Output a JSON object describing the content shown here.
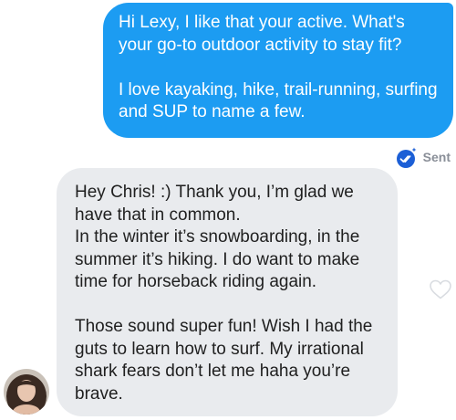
{
  "conversation": {
    "sent_message": {
      "text": "Hi Lexy, I like that your active. What's your go-to outdoor activity to stay fit?\n\nI love kayaking, hike, trail-running, surfing and SUP to name a few.",
      "status_label": "Sent",
      "status_icon": "double-check-icon"
    },
    "received_message": {
      "text": "Hey Chris! :) Thank you, I’m glad we have that in common.\nIn the winter it’s snowboarding, in the summer it’s hiking. I do want to make time for horseback riding again.\n\nThose sound super fun! Wish I had the guts to learn how to surf. My irrational shark fears don’t let me haha you’re brave.",
      "like_icon": "heart-outline-icon",
      "avatar_icon": "avatar"
    }
  },
  "colors": {
    "sent_bubble": "#1c9cf2",
    "received_bubble": "#e9ebee",
    "sent_text": "#ffffff",
    "received_text": "#1f1f1f",
    "status_text": "#8a8f98",
    "status_icon": "#1c5fd6"
  }
}
